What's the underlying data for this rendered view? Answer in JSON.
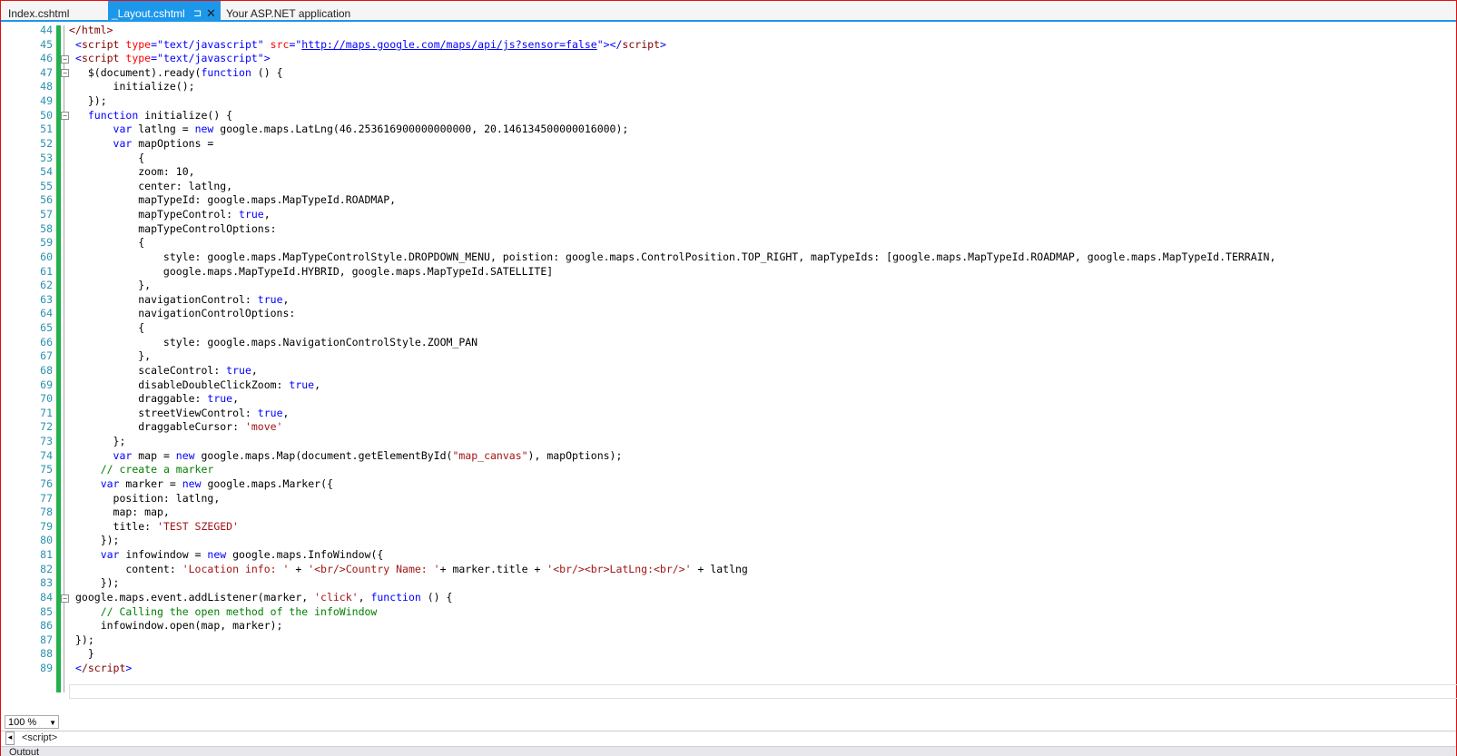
{
  "tabs": {
    "tab1": "Index.cshtml",
    "tab2": "_Layout.cshtml",
    "tab3": "Your ASP.NET application",
    "pin_glyph": "⊐",
    "close_glyph": "✕"
  },
  "editor": {
    "line_numbers": [
      "44",
      "45",
      "46",
      "47",
      "48",
      "49",
      "50",
      "51",
      "52",
      "53",
      "54",
      "55",
      "56",
      "57",
      "58",
      "59",
      "60",
      "61",
      "62",
      "63",
      "64",
      "65",
      "66",
      "67",
      "68",
      "69",
      "70",
      "71",
      "72",
      "73",
      "74",
      "75",
      "76",
      "77",
      "78",
      "79",
      "80",
      "81",
      "82",
      "83",
      "84",
      "85",
      "86",
      "87",
      "88",
      "89"
    ],
    "colors": {
      "keyword": "#0000ff",
      "string": "#a31515",
      "comment": "#008000",
      "line_number": "#2b91af",
      "change_bar": "#22b14c",
      "active_tab": "#1c97ea"
    }
  },
  "lines": {
    "l44": {
      "t1": "</html>"
    },
    "l45": {
      "a": "<",
      "b": "script",
      "c": " type",
      "d": "=\"text/javascript\"",
      "e": " src",
      "f": "=\"",
      "g": "http://maps.google.com/maps/api/js?sensor=false",
      "h": "\"></",
      "i": "script",
      "j": ">"
    },
    "l46": {
      "a": "<",
      "b": "script",
      "c": " type",
      "d": "=\"text/javascript\"",
      "e": ">"
    },
    "l47": {
      "a": "  $(document).ready(",
      "b": "function",
      "c": " () {"
    },
    "l48": {
      "a": "      initialize();"
    },
    "l49": {
      "a": "  });"
    },
    "l50": {
      "a": "  ",
      "b": "function",
      "c": " initialize() {"
    },
    "l51": {
      "a": "      ",
      "b": "var",
      "c": " latlng = ",
      "d": "new",
      "e": " google.maps.LatLng(46.253616900000000000, 20.146134500000016000);"
    },
    "l52": {
      "a": "      ",
      "b": "var",
      "c": " mapOptions ="
    },
    "l53": {
      "a": "          {"
    },
    "l54": {
      "a": "          zoom: 10,"
    },
    "l55": {
      "a": "          center: latlng,"
    },
    "l56": {
      "a": "          mapTypeId: google.maps.MapTypeId.ROADMAP,"
    },
    "l57": {
      "a": "          mapTypeControl: ",
      "b": "true",
      "c": ","
    },
    "l58": {
      "a": "          mapTypeControlOptions:"
    },
    "l59": {
      "a": "          {"
    },
    "l60": {
      "a": "              style: google.maps.MapTypeControlStyle.DROPDOWN_MENU, poistion: google.maps.ControlPosition.TOP_RIGHT, mapTypeIds: [google.maps.MapTypeId.ROADMAP, google.maps.MapTypeId.TERRAIN,"
    },
    "l61": {
      "a": "              google.maps.MapTypeId.HYBRID, google.maps.MapTypeId.SATELLITE]"
    },
    "l62": {
      "a": "          },"
    },
    "l63": {
      "a": "          navigationControl: ",
      "b": "true",
      "c": ","
    },
    "l64": {
      "a": "          navigationControlOptions:"
    },
    "l65": {
      "a": "          {"
    },
    "l66": {
      "a": "              style: google.maps.NavigationControlStyle.ZOOM_PAN"
    },
    "l67": {
      "a": "          },"
    },
    "l68": {
      "a": "          scaleControl: ",
      "b": "true",
      "c": ","
    },
    "l69": {
      "a": "          disableDoubleClickZoom: ",
      "b": "true",
      "c": ","
    },
    "l70": {
      "a": "          draggable: ",
      "b": "true",
      "c": ","
    },
    "l71": {
      "a": "          streetViewControl: ",
      "b": "true",
      "c": ","
    },
    "l72": {
      "a": "          draggableCursor: ",
      "b": "'move'"
    },
    "l73": {
      "a": "      };"
    },
    "l74": {
      "a": "      ",
      "b": "var",
      "c": " map = ",
      "d": "new",
      "e": " google.maps.Map(document.getElementById(",
      "f": "\"map_canvas\"",
      "g": "), mapOptions);"
    },
    "l75": {
      "a": "    ",
      "b": "// create a marker"
    },
    "l76": {
      "a": "    ",
      "b": "var",
      "c": " marker = ",
      "d": "new",
      "e": " google.maps.Marker({"
    },
    "l77": {
      "a": "      position: latlng,"
    },
    "l78": {
      "a": "      map: map,"
    },
    "l79": {
      "a": "      title: ",
      "b": "'TEST SZEGED'"
    },
    "l80": {
      "a": "    });"
    },
    "l81": {
      "a": "    ",
      "b": "var",
      "c": " infowindow = ",
      "d": "new",
      "e": " google.maps.InfoWindow({"
    },
    "l82": {
      "a": "        content: ",
      "b": "'Location info: '",
      "c": " + ",
      "d": "'<br/>Country Name: '",
      "e": "+ marker.title + ",
      "f": "'<br/><br>LatLng:<br/>'",
      "g": " + latlng"
    },
    "l83": {
      "a": "    });"
    },
    "l84": {
      "a": "google.maps.event.addListener(marker, ",
      "b": "'click'",
      "c": ", ",
      "d": "function",
      "e": " () {"
    },
    "l85": {
      "a": "    ",
      "b": "// Calling the open method of the infoWindow"
    },
    "l86": {
      "a": "    infowindow.open(map, marker);"
    },
    "l87": {
      "a": "});"
    },
    "l88": {
      "a": "  }"
    },
    "l89": {
      "a": "<",
      "b": "/script",
      "c": ">"
    }
  },
  "status": {
    "zoom_value": "100 %",
    "nav_path": "<script>",
    "output_label": "Output"
  }
}
